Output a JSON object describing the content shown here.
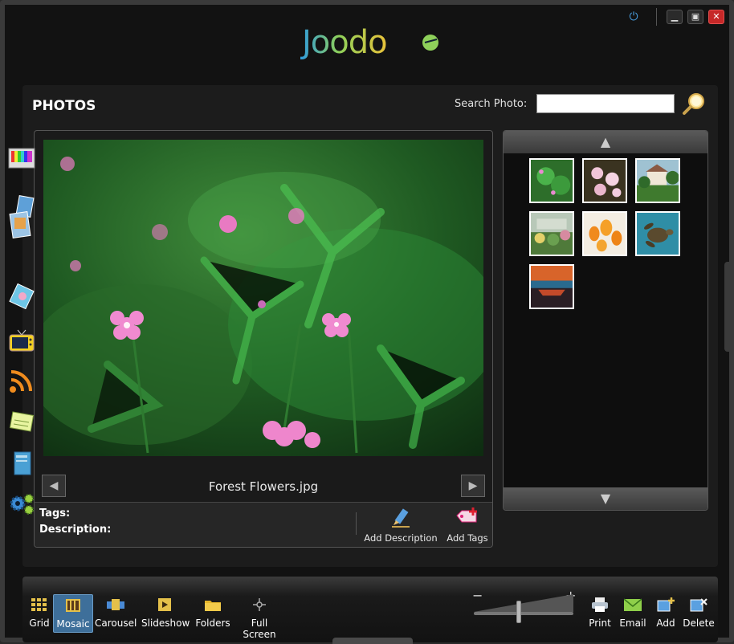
{
  "app": {
    "name": "Joodo",
    "logo_text": "Joodo"
  },
  "window": {
    "controls": [
      "power-icon",
      "minimize-icon",
      "maximize-icon",
      "close-icon"
    ]
  },
  "panel": {
    "title": "PHOTOS",
    "search": {
      "label": "Search Photo:",
      "value": "",
      "placeholder": ""
    }
  },
  "viewer": {
    "filename": "Forest Flowers.jpg",
    "tags_label": "Tags:",
    "description_label": "Description:",
    "add_description_label": "Add Description",
    "add_tags_label": "Add Tags"
  },
  "thumbnails": [
    {
      "name": "green-plant"
    },
    {
      "name": "pink-blossoms"
    },
    {
      "name": "garden-house"
    },
    {
      "name": "garden-plants"
    },
    {
      "name": "orange-tulips"
    },
    {
      "name": "sea-turtle"
    },
    {
      "name": "sunset-boat"
    }
  ],
  "sidebar": {
    "items": [
      {
        "icon": "tv-test-pattern-icon"
      },
      {
        "icon": "photos-stack-icon"
      },
      {
        "icon": "music-cd-icon"
      },
      {
        "icon": "tv-icon"
      },
      {
        "icon": "rss-feed-icon"
      },
      {
        "icon": "notepad-icon"
      },
      {
        "icon": "book-icon"
      },
      {
        "icon": "settings-gears-icon"
      }
    ]
  },
  "toolbar": {
    "views": [
      {
        "label": "Grid",
        "icon": "grid-icon",
        "active": false
      },
      {
        "label": "Mosaic",
        "icon": "mosaic-icon",
        "active": true
      },
      {
        "label": "Carousel",
        "icon": "carousel-icon",
        "active": false
      },
      {
        "label": "Slideshow",
        "icon": "slideshow-icon",
        "active": false
      },
      {
        "label": "Folders",
        "icon": "folder-icon",
        "active": false
      },
      {
        "label": "Full Screen",
        "icon": "fullscreen-icon",
        "active": false
      }
    ],
    "zoom": {
      "minus": "−",
      "plus": "+",
      "level": 0.45
    },
    "actions": [
      {
        "label": "Print",
        "icon": "printer-icon"
      },
      {
        "label": "Email",
        "icon": "email-icon"
      },
      {
        "label": "Add",
        "icon": "add-photo-icon"
      },
      {
        "label": "Delete",
        "icon": "delete-photo-icon"
      }
    ]
  },
  "colors": {
    "accent": "#3e6f9a",
    "close": "#c62828",
    "background": "#121212"
  }
}
